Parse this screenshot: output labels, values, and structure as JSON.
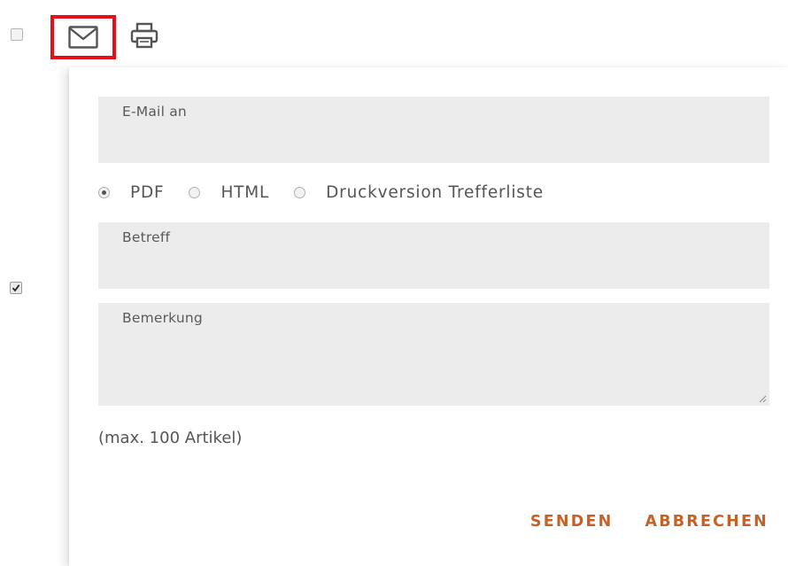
{
  "toolbar": {
    "select_all_checked": false,
    "email_icon": "envelope-icon",
    "print_icon": "printer-icon",
    "highlight_color": "#e3101a"
  },
  "row_checkbox_checked": true,
  "email_form": {
    "recipient_label": "E-Mail an",
    "recipient_value": "",
    "formats": [
      {
        "label": "PDF",
        "selected": true
      },
      {
        "label": "HTML",
        "selected": false
      },
      {
        "label": "Druckversion Trefferliste",
        "selected": false
      }
    ],
    "subject_label": "Betreff",
    "subject_value": "",
    "remark_label": "Bemerkung",
    "remark_value": "",
    "limit_note": "(max. 100 Artikel)",
    "send_label": "SENDEN",
    "cancel_label": "ABBRECHEN",
    "accent_color": "#c76226"
  }
}
